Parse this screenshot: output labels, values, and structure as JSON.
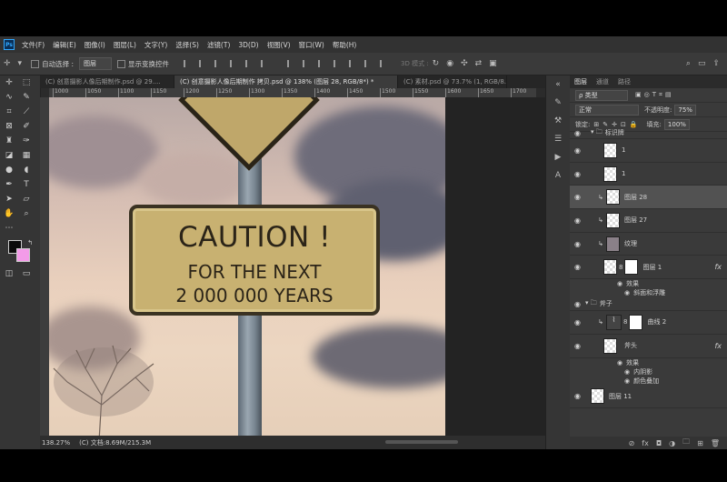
{
  "menubar": {
    "logo": "Ps",
    "items": [
      "文件(F)",
      "编辑(E)",
      "图像(I)",
      "图层(L)",
      "文字(Y)",
      "选择(S)",
      "滤镜(T)",
      "3D(D)",
      "视图(V)",
      "窗口(W)",
      "帮助(H)"
    ]
  },
  "options": {
    "auto_select_label": "自动选择 :",
    "auto_select_value": "图层",
    "show_transform_label": "显示变换控件",
    "mode_3d_label": "3D 模式 :"
  },
  "tabs": [
    {
      "label": "(C) 创意摄影人像后期制作.psd @ 29....",
      "active": false
    },
    {
      "label": "(C) 创意摄影人像后期制作 拷贝.psd @ 138% (图层 28, RGB/8*) *",
      "active": true
    },
    {
      "label": "(C) 素材.psd @ 73.7% (1, RGB/8...",
      "active": false
    }
  ],
  "ruler": {
    "labels": [
      "1000",
      "1050",
      "1100",
      "1150",
      "1200",
      "1250",
      "1300",
      "1350",
      "1400",
      "1450",
      "1500",
      "1550",
      "1600",
      "1650",
      "1700",
      "1750"
    ]
  },
  "canvas": {
    "sign_line1": "CAUTION !",
    "sign_line2": "FOR THE NEXT",
    "sign_line3": "2 000 000 YEARS"
  },
  "status": {
    "zoom": "138.27%",
    "doc": "(C) 文档:8.69M/215.3M"
  },
  "layers_panel": {
    "tabs": [
      "图层",
      "通道",
      "路径"
    ],
    "filter_label": "ρ 类型",
    "blend_mode": "正常",
    "opacity_label": "不透明度:",
    "opacity_value": "75%",
    "lock_label": "锁定:",
    "fill_label": "填充:",
    "fill_value": "100%",
    "group_top": "标识牌",
    "layers": [
      {
        "name": "1"
      },
      {
        "name": "1"
      },
      {
        "name": "图层 28"
      },
      {
        "name": "图层 27"
      },
      {
        "name": "纹理"
      },
      {
        "name": "图层 1"
      }
    ],
    "effects_label": "效果",
    "effect_bevel": "斜面和浮雕",
    "group_axe": "斧子",
    "curves_layer": "曲线 2",
    "axe_head": "斧头",
    "effect_inner_shadow": "内阴影",
    "effect_color_overlay": "颜色叠加",
    "layer_11": "图层 11",
    "fx": "fx"
  }
}
